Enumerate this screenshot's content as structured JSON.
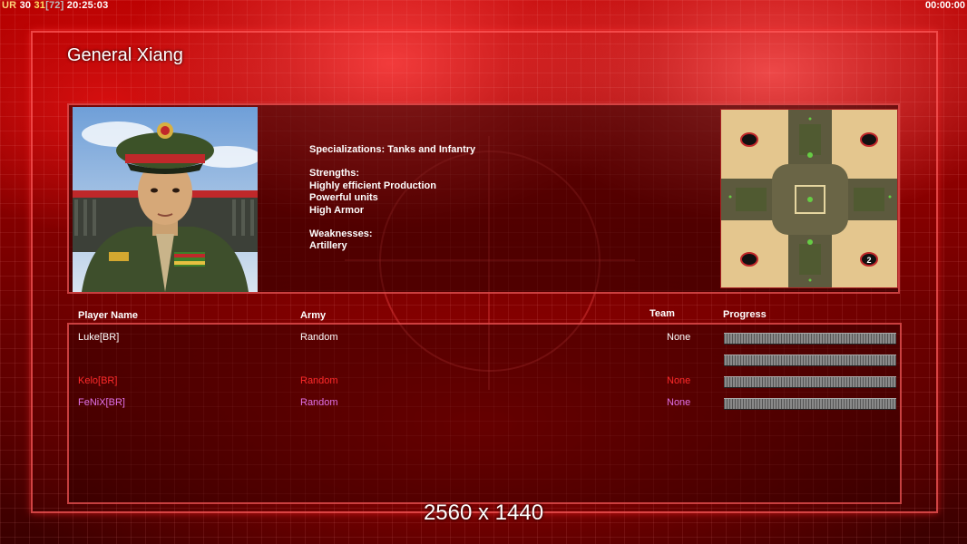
{
  "hud": {
    "prefix": "UR",
    "fps": "30",
    "fps2": "31",
    "cap": "[72]",
    "clock": "20:25:03",
    "timer": "00:00:00"
  },
  "general": {
    "name": "General Xiang",
    "specializations": "Specializations: Tanks and Infantry",
    "strengths_heading": "Strengths:",
    "strengths": [
      "Highly efficient Production",
      "Powerful units",
      "High Armor"
    ],
    "weaknesses_heading": "Weaknesses:",
    "weaknesses": [
      "Artillery"
    ]
  },
  "minimap": {
    "start_marker": "2"
  },
  "players_table": {
    "headers": {
      "player": "Player Name",
      "army": "Army",
      "team": "Team",
      "progress": "Progress"
    },
    "rows": [
      {
        "name": "Luke[BR]",
        "army": "Random",
        "team": "None",
        "color": "#ffffff"
      },
      {
        "name": "",
        "army": "",
        "team": "",
        "color": "#5a0000"
      },
      {
        "name": "Kelo[BR]",
        "army": "Random",
        "team": "None",
        "color": "#ff2a2a"
      },
      {
        "name": "FeNiX[BR]",
        "army": "Random",
        "team": "None",
        "color": "#e070e8"
      }
    ]
  },
  "resolution": "2560 x 1440"
}
